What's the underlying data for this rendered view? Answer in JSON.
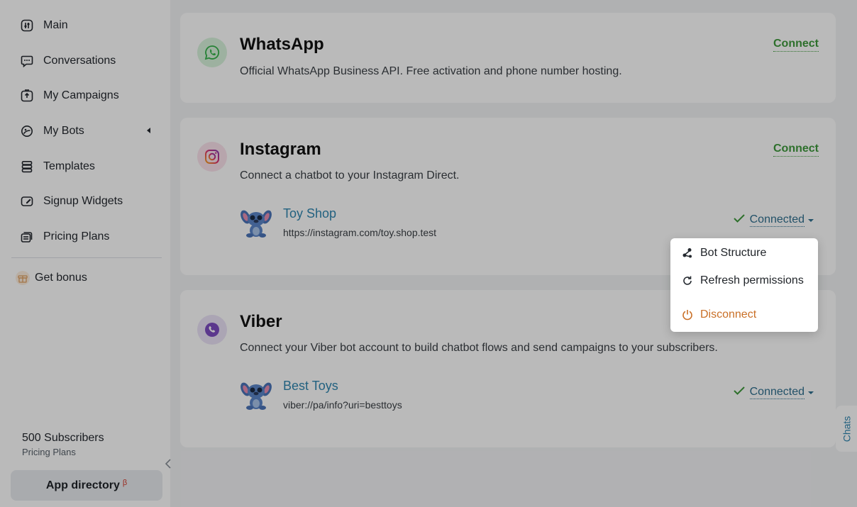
{
  "sidebar": {
    "items": [
      {
        "label": "Main",
        "icon": "main-icon"
      },
      {
        "label": "Conversations",
        "icon": "chat-icon"
      },
      {
        "label": "My Campaigns",
        "icon": "campaign-icon"
      },
      {
        "label": "My Bots",
        "icon": "bot-icon"
      },
      {
        "label": "Templates",
        "icon": "templates-icon"
      },
      {
        "label": "Signup Widgets",
        "icon": "widget-icon"
      },
      {
        "label": "Pricing Plans",
        "icon": "pricing-icon"
      }
    ],
    "bonus": {
      "label": "Get bonus",
      "icon": "gift-icon"
    },
    "subscribers": "500 Subscribers",
    "plan_link": "Pricing Plans",
    "app_directory": "App directory",
    "beta": "β"
  },
  "cards": [
    {
      "title": "WhatsApp",
      "description": "Official WhatsApp Business API. Free activation and phone number hosting.",
      "action": "Connect",
      "icon": "whatsapp-icon"
    },
    {
      "title": "Instagram",
      "description": "Connect a chatbot to your Instagram Direct.",
      "action": "Connect",
      "icon": "instagram-icon",
      "account": {
        "name": "Toy Shop",
        "url": "https://instagram.com/toy.shop.test",
        "status": "Connected"
      }
    },
    {
      "title": "Viber",
      "description": "Connect your Viber bot account to build chatbot flows and send campaigns to your subscribers.",
      "icon": "viber-icon",
      "account": {
        "name": "Best Toys",
        "url": "viber://pa/info?uri=besttoys",
        "status": "Connected"
      }
    }
  ],
  "dropdown": {
    "items": [
      {
        "label": "Bot Structure",
        "icon": "structure-icon"
      },
      {
        "label": "Refresh permissions",
        "icon": "refresh-icon"
      },
      {
        "label": "Disconnect",
        "icon": "power-icon"
      }
    ]
  },
  "chats_tab": "Chats",
  "colors": {
    "accent_green": "#3f9a3d",
    "link_blue": "#2f86b0",
    "danger_orange": "#c96f26"
  }
}
